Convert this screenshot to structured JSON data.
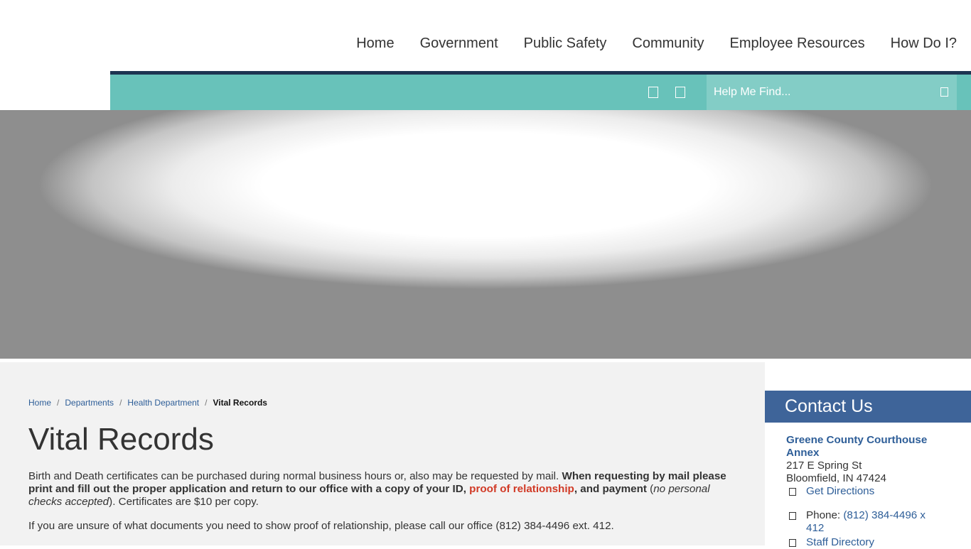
{
  "nav": {
    "items": [
      "Home",
      "Government",
      "Public Safety",
      "Community",
      "Employee Resources",
      "How Do I?"
    ]
  },
  "utility": {
    "search_placeholder": "Help Me Find..."
  },
  "breadcrumb": {
    "items": [
      "Home",
      "Departments",
      "Health Department"
    ],
    "current": "Vital Records"
  },
  "page": {
    "title": "Vital Records",
    "p1_intro": "Birth and Death certificates can be purchased during normal business hours or, also may be requested by mail.  ",
    "p1_bold": "When requesting by mail please print and fill out the proper application and return to our office with a copy of your ID, ",
    "p1_link": "proof of relationship",
    "p1_bold_end": ", and payment",
    "p1_paren_open": " (",
    "p1_italic": "no personal checks accepted",
    "p1_tail": "). Certificates are $10 per copy.",
    "p2": "If you are unsure of what documents you need to show proof of relationship, please call our office (812) 384-4496 ext. 412."
  },
  "contact": {
    "heading": "Contact Us",
    "org": "Greene County Courthouse Annex",
    "street": "217 E Spring St",
    "city": "Bloomfield, IN 47424",
    "directions": "Get Directions",
    "phone_label": "Phone: ",
    "phone": "(812) 384-4496 x 412",
    "staff": "Staff Directory"
  },
  "colors": {
    "teal_bar": "#68c2ba",
    "navy_rule": "#1d3451",
    "contact_header": "#3e6499",
    "link_blue": "#2e5e98",
    "link_red": "#d13a26"
  }
}
